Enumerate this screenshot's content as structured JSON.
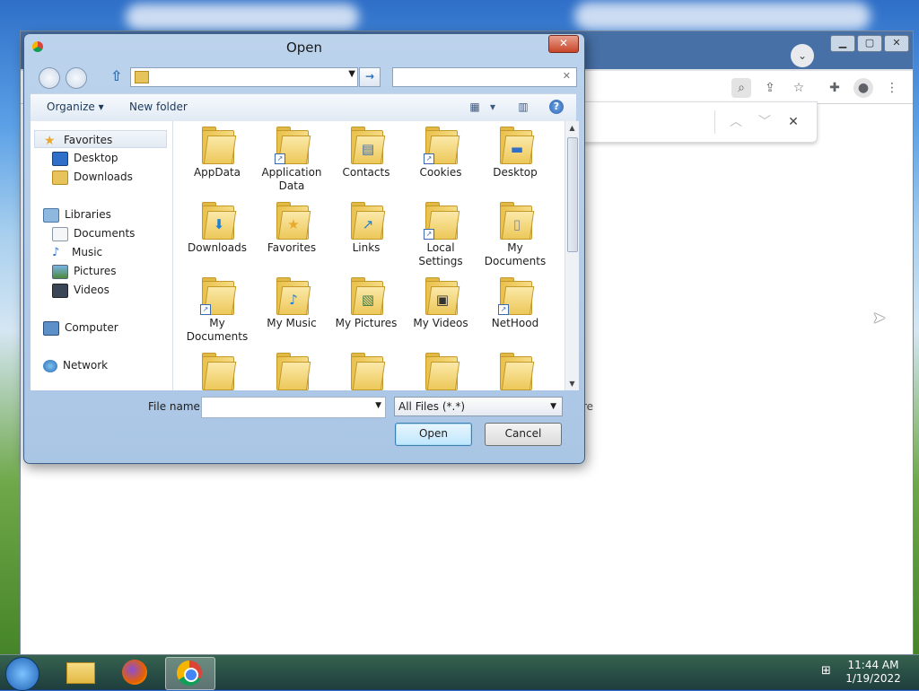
{
  "dialog": {
    "title": "Open",
    "close": "✕",
    "address": {
      "path": ""
    },
    "search": {
      "placeholder": ""
    },
    "toolbar": {
      "organize": "Organize ▾",
      "new_folder": "New folder",
      "help": "?"
    },
    "nav": {
      "favorites": "Favorites",
      "desktop": "Desktop",
      "downloads": "Downloads",
      "libraries": "Libraries",
      "documents": "Documents",
      "music": "Music",
      "pictures": "Pictures",
      "videos": "Videos",
      "computer": "Computer",
      "network": "Network"
    },
    "files": [
      {
        "name": "AppData",
        "icon": "folder"
      },
      {
        "name": "Application Data",
        "icon": "folder-shortcut"
      },
      {
        "name": "Contacts",
        "icon": "folder-contacts"
      },
      {
        "name": "Cookies",
        "icon": "folder-shortcut"
      },
      {
        "name": "Desktop",
        "icon": "folder-desktop"
      },
      {
        "name": "Downloads",
        "icon": "folder-downloads"
      },
      {
        "name": "Favorites",
        "icon": "folder-star"
      },
      {
        "name": "Links",
        "icon": "folder-links"
      },
      {
        "name": "Local Settings",
        "icon": "folder-shortcut"
      },
      {
        "name": "My Documents",
        "icon": "folder-documents"
      },
      {
        "name": "My Documents",
        "icon": "folder-shortcut"
      },
      {
        "name": "My Music",
        "icon": "folder-music"
      },
      {
        "name": "My Pictures",
        "icon": "folder-pictures"
      },
      {
        "name": "My Videos",
        "icon": "folder-videos"
      },
      {
        "name": "NetHood",
        "icon": "folder-shortcut"
      }
    ],
    "file_name_label": "File name:",
    "file_name_value": "",
    "file_type": "All Files (*.*)",
    "open_button": "Open",
    "cancel_button": "Cancel"
  },
  "background": {
    "partial_text": "re"
  },
  "taskbar": {
    "time": "11:44 AM",
    "date": "1/19/2022"
  }
}
